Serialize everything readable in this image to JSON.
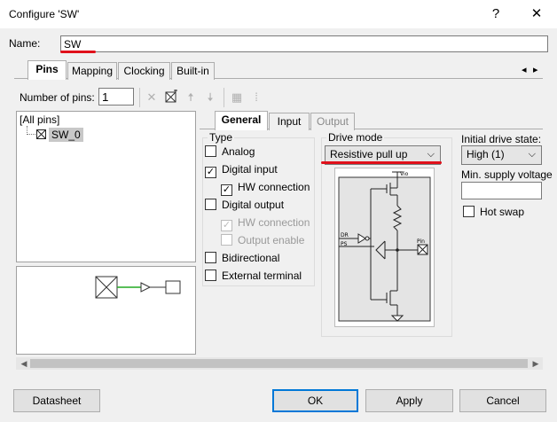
{
  "window": {
    "title": "Configure 'SW'",
    "help_glyph": "?",
    "close_glyph": "✕"
  },
  "name_field": {
    "label": "Name:",
    "value": "SW"
  },
  "main_tabs": [
    {
      "label": "Pins",
      "active": true
    },
    {
      "label": "Mapping"
    },
    {
      "label": "Clocking"
    },
    {
      "label": "Built-in"
    }
  ],
  "tab_scroll": {
    "left": "◂",
    "right": "▸"
  },
  "toolbar": {
    "num_pins_label": "Number of pins:",
    "num_pins_value": "1"
  },
  "tree": {
    "root": "[All pins]",
    "child": "SW_0"
  },
  "sub_tabs": [
    {
      "label": "General",
      "active": true
    },
    {
      "label": "Input"
    },
    {
      "label": "Output",
      "disabled": true
    }
  ],
  "type_group": {
    "title": "Type",
    "options": [
      {
        "label": "Analog",
        "checked": false,
        "disabled": false
      },
      {
        "label": "Digital input",
        "checked": true,
        "disabled": false
      },
      {
        "label": "HW connection",
        "checked": true,
        "disabled": false
      },
      {
        "label": "Digital output",
        "checked": false,
        "disabled": false
      },
      {
        "label": "HW connection",
        "checked": true,
        "disabled": true
      },
      {
        "label": "Output enable",
        "checked": false,
        "disabled": true
      },
      {
        "label": "Bidirectional",
        "checked": false,
        "disabled": false
      },
      {
        "label": "External terminal",
        "checked": false,
        "disabled": false
      }
    ]
  },
  "drive_mode": {
    "label": "Drive mode",
    "value": "Resistive pull up",
    "schematic_labels": {
      "vio": "Vio",
      "dr": "DR",
      "ps": "PS",
      "pin": "Pin"
    }
  },
  "initial_drive_state": {
    "label": "Initial drive state:",
    "value": "High (1)"
  },
  "min_supply_voltage": {
    "label": "Min. supply voltage",
    "value": ""
  },
  "hot_swap": {
    "label": "Hot swap",
    "checked": false
  },
  "buttons": {
    "datasheet": "Datasheet",
    "ok": "OK",
    "apply": "Apply",
    "cancel": "Cancel"
  },
  "colors": {
    "annotation_red": "#e0101a",
    "default_button_border": "#0078d7",
    "preview_wire": "#22aa22"
  }
}
